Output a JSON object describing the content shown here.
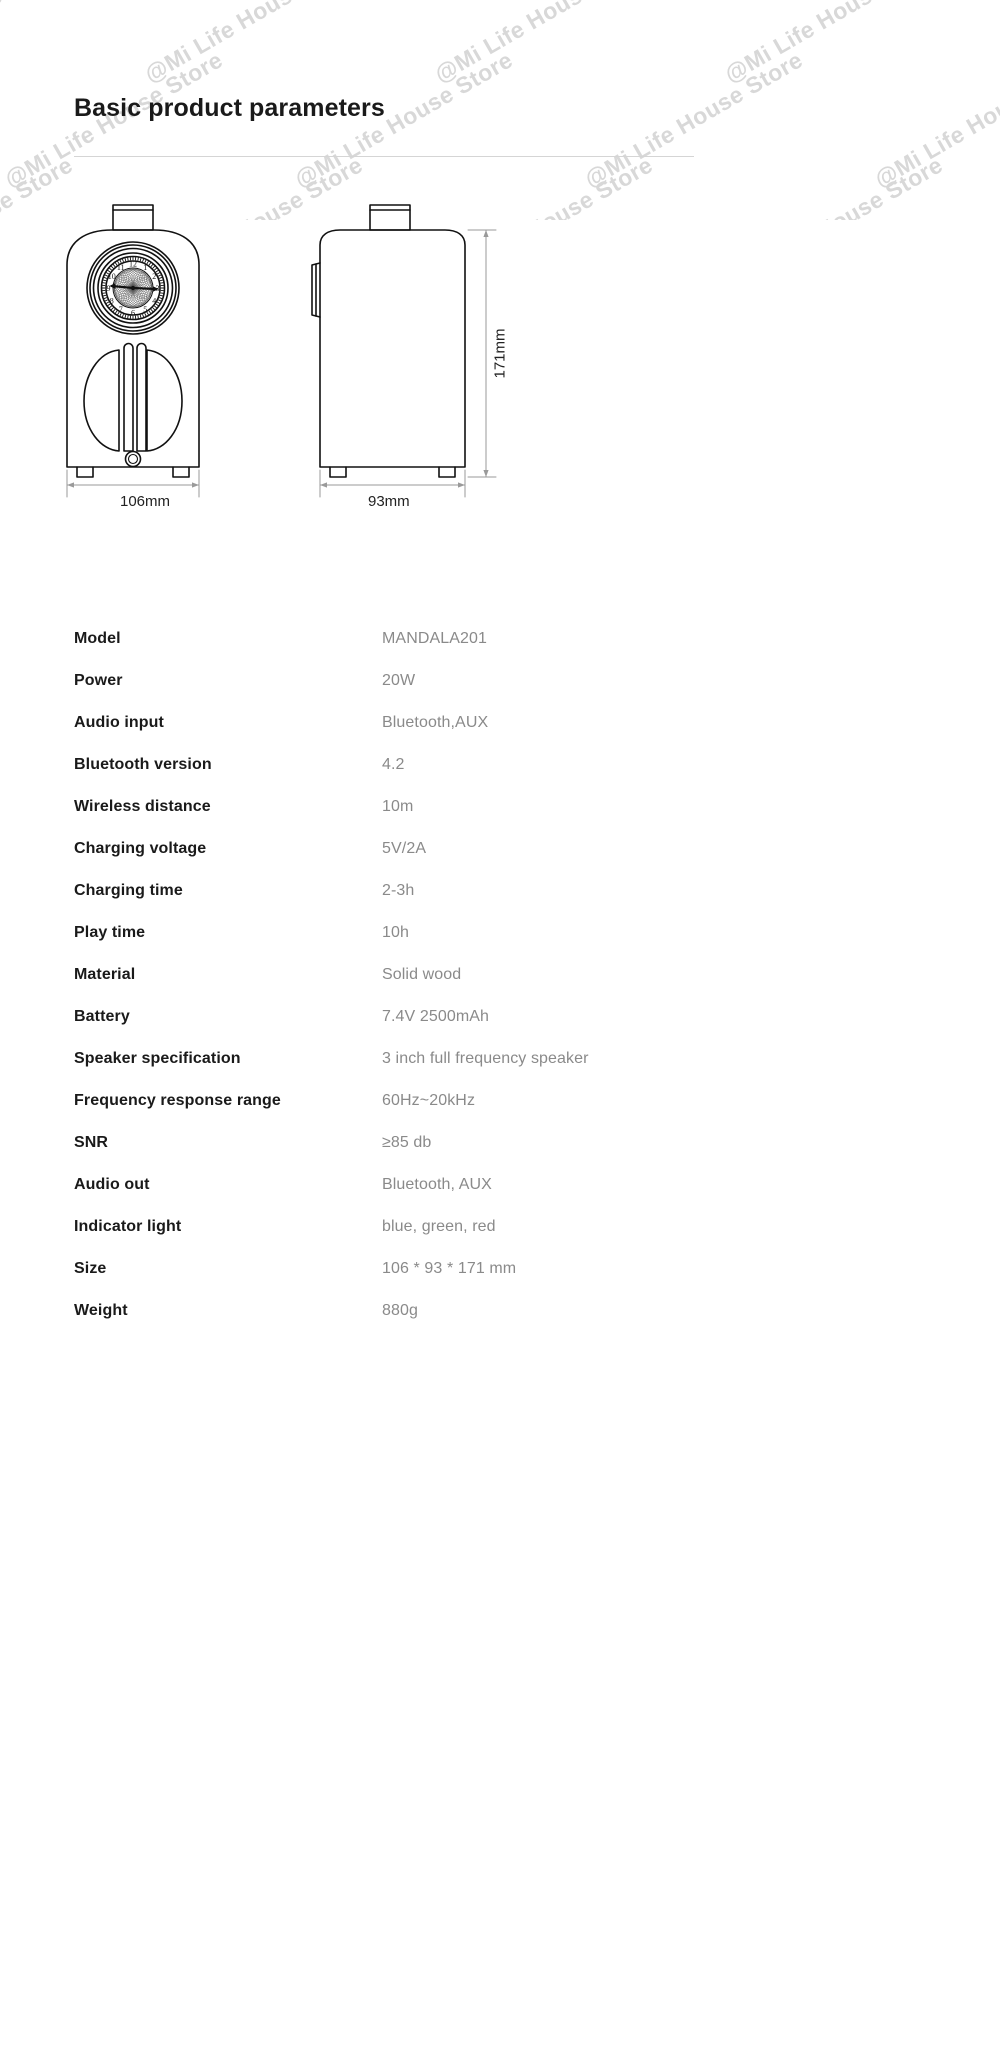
{
  "page": {
    "title": "Basic product parameters",
    "background_color": "#ffffff",
    "label_color": "#1a1a1a",
    "value_color": "#8a8a8a",
    "rule_color": "#d5d5d5"
  },
  "watermark": {
    "text": "@Mi Life House Store",
    "color": "#d8d8d8"
  },
  "diagram": {
    "front_view": {
      "name": "front-view",
      "clock_numerals": [
        "12",
        "1",
        "2",
        "3",
        "4",
        "5",
        "6",
        "7",
        "8",
        "9",
        "10",
        "11"
      ],
      "width_label": "106mm"
    },
    "side_view": {
      "name": "side-view",
      "depth_label": "93mm",
      "height_label": "171mm"
    }
  },
  "spec_table": {
    "rows": [
      {
        "label": "Model",
        "value": "MANDALA201"
      },
      {
        "label": "Power",
        "value": "20W"
      },
      {
        "label": "Audio input",
        "value": "Bluetooth,AUX"
      },
      {
        "label": "Bluetooth version",
        "value": "4.2"
      },
      {
        "label": "Wireless distance",
        "value": "10m"
      },
      {
        "label": "Charging voltage",
        "value": "5V/2A"
      },
      {
        "label": "Charging time",
        "value": "2-3h"
      },
      {
        "label": "Play time",
        "value": "10h"
      },
      {
        "label": "Material",
        "value": "Solid wood"
      },
      {
        "label": "Battery",
        "value": "7.4V 2500mAh"
      },
      {
        "label": "Speaker specification",
        "value": "3 inch full frequency speaker"
      },
      {
        "label": "Frequency response range",
        "value": "60Hz~20kHz"
      },
      {
        "label": "SNR",
        "value": "≥85 db"
      },
      {
        "label": "Audio out",
        "value": "Bluetooth, AUX"
      },
      {
        "label": "Indicator light",
        "value": "blue, green, red"
      },
      {
        "label": "Size",
        "value": "106 * 93 * 171 mm"
      },
      {
        "label": "Weight",
        "value": "880g"
      }
    ]
  }
}
